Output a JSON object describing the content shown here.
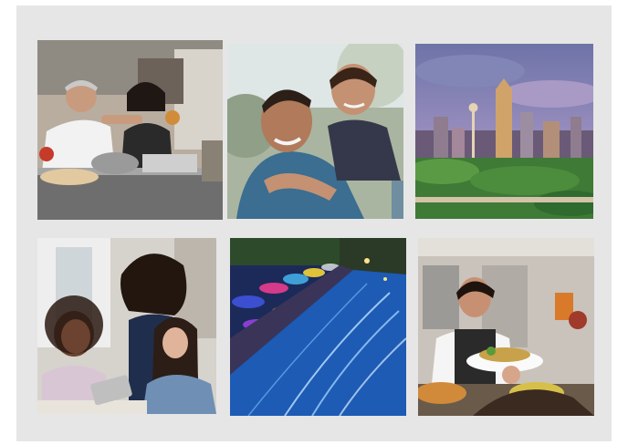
{
  "collage": {
    "photos": [
      {
        "id": "food-service-volunteers",
        "depicts": "food-service-volunteers-image"
      },
      {
        "id": "father-son-piggyback",
        "depicts": "father-son-piggyback-image"
      },
      {
        "id": "san-antonio-skyline",
        "depicts": "city-skyline-image"
      },
      {
        "id": "teacher-with-students",
        "depicts": "teacher-students-image"
      },
      {
        "id": "riverwalk-night",
        "depicts": "riverwalk-night-image"
      },
      {
        "id": "kitchen-serving-food",
        "depicts": "kitchen-serving-image"
      }
    ]
  }
}
